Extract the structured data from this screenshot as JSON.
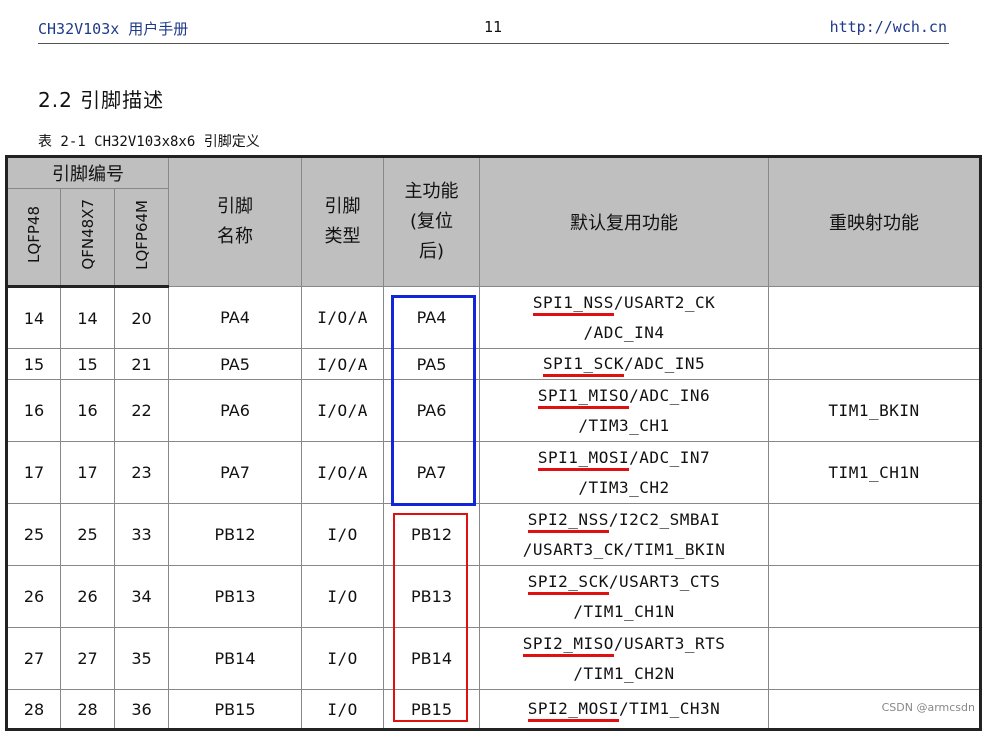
{
  "header": {
    "left": "CH32V103x 用户手册",
    "page": "11",
    "right": "http://wch.cn"
  },
  "section_title": "2.2 引脚描述",
  "table_caption": "表 2-1 CH32V103x8x6 引脚定义",
  "columns": {
    "pin_number_group": "引脚编号",
    "lqfp48": "LQFP48",
    "qfn48x7": "QFN48X7",
    "lqfp64m": "LQFP64M",
    "pin_name": "引脚\n名称",
    "pin_type": "引脚\n类型",
    "main_function": "主功能\n(复位\n后)",
    "default_alt": "默认复用功能",
    "remap": "重映射功能"
  },
  "rows": [
    {
      "lqfp48": "14",
      "qfn": "14",
      "lqfp64": "20",
      "name": "PA4",
      "type": "I/O/A",
      "main": "PA4",
      "alt_u": "SPI1_NSS",
      "alt_rest": "/USART2_CK",
      "alt_line2": "/ADC_IN4",
      "remap": ""
    },
    {
      "lqfp48": "15",
      "qfn": "15",
      "lqfp64": "21",
      "name": "PA5",
      "type": "I/O/A",
      "main": "PA5",
      "alt_u": "SPI1_SCK",
      "alt_rest": "/ADC_IN5",
      "alt_line2": "",
      "remap": ""
    },
    {
      "lqfp48": "16",
      "qfn": "16",
      "lqfp64": "22",
      "name": "PA6",
      "type": "I/O/A",
      "main": "PA6",
      "alt_u": "SPI1_MISO",
      "alt_rest": "/ADC_IN6",
      "alt_line2": "/TIM3_CH1",
      "remap": "TIM1_BKIN"
    },
    {
      "lqfp48": "17",
      "qfn": "17",
      "lqfp64": "23",
      "name": "PA7",
      "type": "I/O/A",
      "main": "PA7",
      "alt_u": "SPI1_MOSI",
      "alt_rest": "/ADC_IN7",
      "alt_line2": "/TIM3_CH2",
      "remap": "TIM1_CH1N"
    },
    {
      "lqfp48": "25",
      "qfn": "25",
      "lqfp64": "33",
      "name": "PB12",
      "type": "I/O",
      "main": "PB12",
      "alt_u": "SPI2_NSS",
      "alt_rest": "/I2C2_SMBAI",
      "alt_line2": "/USART3_CK/TIM1_BKIN",
      "remap": ""
    },
    {
      "lqfp48": "26",
      "qfn": "26",
      "lqfp64": "34",
      "name": "PB13",
      "type": "I/O",
      "main": "PB13",
      "alt_u": "SPI2_SCK",
      "alt_rest": "/USART3_CTS",
      "alt_line2": "/TIM1_CH1N",
      "remap": ""
    },
    {
      "lqfp48": "27",
      "qfn": "27",
      "lqfp64": "35",
      "name": "PB14",
      "type": "I/O",
      "main": "PB14",
      "alt_u": "SPI2_MISO",
      "alt_rest": "/USART3_RTS",
      "alt_line2": "/TIM1_CH2N",
      "remap": ""
    },
    {
      "lqfp48": "28",
      "qfn": "28",
      "lqfp64": "36",
      "name": "PB15",
      "type": "I/O",
      "main": "PB15",
      "alt_u": "SPI2_MOSI",
      "alt_rest": "/TIM1_CH3N",
      "alt_line2": "",
      "remap": ""
    }
  ],
  "annotation_colors": {
    "blue_box": "#1226d8",
    "red_box": "#e01010",
    "underline": "#e01010"
  },
  "watermark": "CSDN @armcsdn"
}
